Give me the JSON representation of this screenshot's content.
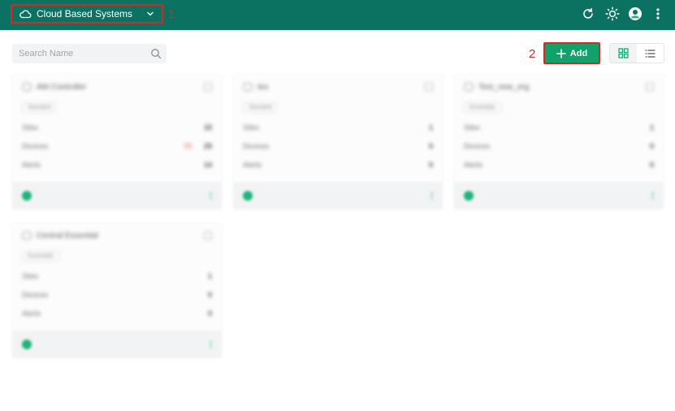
{
  "header": {
    "system_selector": {
      "label": "Cloud Based Systems",
      "icon": "cloud-icon"
    },
    "annotation_1": "1",
    "icons": [
      "refresh-icon",
      "sun-icon",
      "user-avatar-icon",
      "more-vert-icon"
    ]
  },
  "toolbar": {
    "search_placeholder": "Search Name",
    "annotation_2": "2",
    "add_label": "Add",
    "views": [
      "grid-view-icon",
      "list-view-icon"
    ]
  },
  "cards": [
    {
      "name": "AM Controller",
      "badge": "Standard",
      "rows": [
        {
          "label": "Sites",
          "value": "15"
        },
        {
          "label": "Devices",
          "value": "25",
          "warning": "1|1"
        },
        {
          "label": "Alerts",
          "value": "14"
        }
      ]
    },
    {
      "name": "tes",
      "badge": "Standard",
      "rows": [
        {
          "label": "Sites",
          "value": "1"
        },
        {
          "label": "Devices",
          "value": "0"
        },
        {
          "label": "Alerts",
          "value": "0"
        }
      ]
    },
    {
      "name": "Test_new_org",
      "badge": "Essentials",
      "rows": [
        {
          "label": "Sites",
          "value": "1"
        },
        {
          "label": "Devices",
          "value": "0"
        },
        {
          "label": "Alerts",
          "value": "0"
        }
      ]
    },
    {
      "name": "Central Essential",
      "badge": "Essentials",
      "rows": [
        {
          "label": "Sites",
          "value": "1"
        },
        {
          "label": "Devices",
          "value": "0"
        },
        {
          "label": "Alerts",
          "value": "0"
        }
      ]
    }
  ],
  "colors": {
    "header_bg": "#0b7160",
    "accent": "#12a06b",
    "annotation": "#e02424"
  }
}
